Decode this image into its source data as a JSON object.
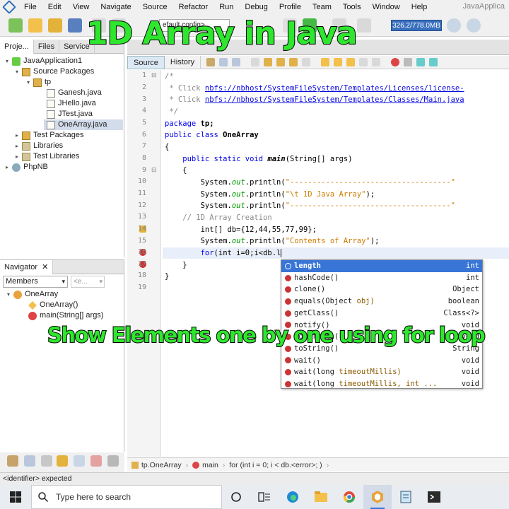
{
  "menu": {
    "items": [
      "File",
      "Edit",
      "View",
      "Navigate",
      "Source",
      "Refactor",
      "Run",
      "Debug",
      "Profile",
      "Team",
      "Tools",
      "Window",
      "Help"
    ],
    "window_title": "JavaApplica"
  },
  "toolbar": {
    "config_value": "efault config>",
    "memory_meter": "326.2/778.0MB"
  },
  "captions": {
    "title": "1D Array in Java",
    "subtitle": "Show Elements one by one using for loop"
  },
  "projects": {
    "tabs": [
      "Proje...",
      "Files",
      "Service"
    ],
    "tree": [
      {
        "label": "JavaApplication1",
        "icon": "project-icon"
      },
      {
        "label": "Source Packages",
        "icon": "package-folder-icon"
      },
      {
        "label": "tp",
        "icon": "package-icon"
      },
      {
        "label": "Ganesh.java",
        "icon": "java-file-icon"
      },
      {
        "label": "JHello.java",
        "icon": "java-file-icon"
      },
      {
        "label": "JTest.java",
        "icon": "java-file-icon"
      },
      {
        "label": "OneArray.java",
        "icon": "java-file-icon"
      },
      {
        "label": "Test Packages",
        "icon": "package-folder-icon"
      },
      {
        "label": "Libraries",
        "icon": "library-icon"
      },
      {
        "label": "Test Libraries",
        "icon": "library-icon"
      },
      {
        "label": "PhpNB",
        "icon": "php-project-icon"
      }
    ]
  },
  "navigator": {
    "title": "Navigator",
    "members_label": "Members",
    "filter_placeholder": "<e...",
    "tree": [
      {
        "label": "OneArray",
        "icon": "class-icon"
      },
      {
        "label": "OneArray()",
        "icon": "constructor-icon"
      },
      {
        "label": "main(String[] args)",
        "icon": "method-icon"
      }
    ]
  },
  "editor": {
    "tabs": [
      "Source",
      "History"
    ],
    "line_numbers": [
      "1",
      "2",
      "3",
      "4",
      "5",
      "6",
      "7",
      "8",
      "9",
      "10",
      "11",
      "12",
      "13",
      "14",
      "15",
      "16",
      "17",
      "18",
      "19"
    ],
    "code": {
      "l1": "/*",
      "l2a": " * Click ",
      "l2b": "nbfs://nbhost/SystemFileSystem/Templates/Licenses/license-",
      "l3a": " * Click ",
      "l3b": "nbfs://nbhost/SystemFileSystem/Templates/Classes/Main.java",
      "l4": " */",
      "l5a": "package",
      "l5b": " tp;",
      "l6a": "public class",
      "l6b": " OneArray",
      "l7": "{",
      "l8a": "    public static void",
      "l8b": " main",
      "l8c": "(String[] args)",
      "l9": "    {",
      "l10a": "        System.",
      "l10b": "out",
      "l10c": ".println(",
      "l10d": "\"------------------------------------\"",
      "l11a": "        System.",
      "l11b": "out",
      "l11c": ".println(",
      "l11d": "\"\\t 1D Java Array\"",
      "l11e": ");",
      "l12a": "        System.",
      "l12b": "out",
      "l12c": ".println(",
      "l12d": "\"------------------------------------\"",
      "l13": "    // 1D Array Creation",
      "l14": "        int[] db={12,44,55,77,99};",
      "l15a": "        System.",
      "l15b": "out",
      "l15c": ".println(",
      "l15d": "\"Contents of Array\"",
      "l15e": ");",
      "l16a": "        for",
      "l16b": "(int i=0;i<db.l",
      "l17": "    }",
      "l18": "}"
    }
  },
  "completion": {
    "items": [
      {
        "name": "length",
        "params": "",
        "type": "int"
      },
      {
        "name": "hashCode()",
        "params": "",
        "type": "int"
      },
      {
        "name": "clone()",
        "params": "",
        "type": "Object"
      },
      {
        "name": "equals(Object ",
        "params": "obj)",
        "type": "boolean"
      },
      {
        "name": "getClass()",
        "params": "",
        "type": "Class<?>"
      },
      {
        "name": "notify()",
        "params": "",
        "type": "void"
      },
      {
        "name": "notifyAll()",
        "params": "",
        "type": "void"
      },
      {
        "name": "toString()",
        "params": "",
        "type": "String"
      },
      {
        "name": "wait()",
        "params": "",
        "type": "void"
      },
      {
        "name": "wait(long ",
        "params": "timeoutMillis)",
        "type": "void"
      },
      {
        "name": "wait(long ",
        "params": "timeoutMillis, int ...",
        "type": "void"
      }
    ]
  },
  "breadcrumb": {
    "items": [
      "tp.OneArray",
      "main",
      "for (int i = 0; i < db.<error>; )"
    ]
  },
  "status": {
    "message": "<identifier> expected"
  },
  "taskbar": {
    "search_placeholder": "Type here to search"
  },
  "colors": {
    "caption_green": "#2ee62e",
    "selection_blue": "#3875d7",
    "keyword_blue": "#0000e6",
    "string_orange": "#ce7b00",
    "error_red": "#cc3333"
  }
}
